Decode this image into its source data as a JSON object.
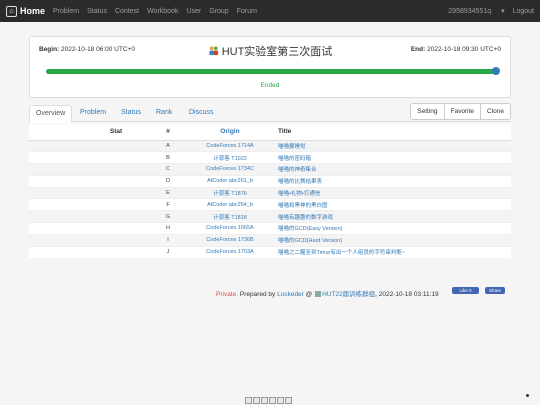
{
  "navbar": {
    "brand": "Home",
    "items": [
      "Problem",
      "Status",
      "Contest",
      "Workbook",
      "User",
      "Group",
      "Forum"
    ],
    "username": "2958934551q",
    "logout": "Logout"
  },
  "contest": {
    "begin_label": "Begin:",
    "begin_time": "2022-10-18 06:00 UTC+0",
    "end_label": "End:",
    "end_time": "2022-10-18 09:30 UTC+0",
    "title": "HUT实验室第三次面试",
    "status": "Ended",
    "progress": 1.0
  },
  "tabs": [
    "Overview",
    "Problem",
    "Status",
    "Rank",
    "Discuss"
  ],
  "actions": [
    "Setting",
    "Favorite",
    "Clone"
  ],
  "table": {
    "headers": [
      "Stat",
      "#",
      "Origin",
      "Title"
    ],
    "rows": [
      {
        "num": "A",
        "origin": "CodeForces 1714A",
        "title": "喵喵要睡觉"
      },
      {
        "num": "B",
        "origin": "计蒜客 T1022",
        "title": "喵喵的密码箱"
      },
      {
        "num": "C",
        "origin": "CodeForces 1734C",
        "title": "喵喵的神奇集合"
      },
      {
        "num": "D",
        "origin": "AtCoder abc261_b",
        "title": "喵喵的比赛结果表"
      },
      {
        "num": "E",
        "origin": "计蒜客 T1876",
        "title": "喵喵•礼物•打通信"
      },
      {
        "num": "F",
        "origin": "AtCoder abc264_b",
        "title": "喵喵和黑神的黑白图"
      },
      {
        "num": "G",
        "origin": "计蒜客 T1818",
        "title": "喵喵有趣趣的数字游戏"
      },
      {
        "num": "H",
        "origin": "CodeForces 1665A",
        "title": "喵喵的GCD(Easy Version)"
      },
      {
        "num": "I",
        "origin": "CodeForces 1736B",
        "title": "喵喵的GCD(Hard Version)"
      },
      {
        "num": "J",
        "origin": "CodeForces 1703A",
        "title": "喵喵之二醒至到Timur有出一个人组员的字符串判断~"
      }
    ]
  },
  "footer": {
    "private": "Private.",
    "prepared_by": "Prepared by",
    "author": "Lockeder",
    "at": "@",
    "group": "HUT22届训练群组",
    "timestamp": ", 2022-10-18 03:11:19",
    "like": "Like 0",
    "share": "Share"
  },
  "colors": {
    "navbar_bg": "#2b2b2b",
    "link": "#337ab7",
    "progress": "#2aa745",
    "private": "#d9534f"
  }
}
